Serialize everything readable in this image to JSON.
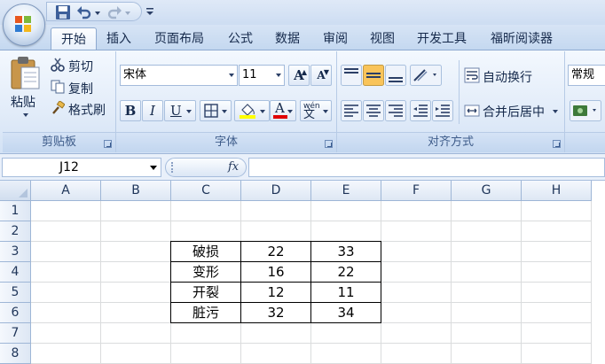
{
  "tabs": [
    "开始",
    "插入",
    "页面布局",
    "公式",
    "数据",
    "审阅",
    "视图",
    "开发工具",
    "福昕阅读器"
  ],
  "clipboard": {
    "paste": "粘贴",
    "cut": "剪切",
    "copy": "复制",
    "format_painter": "格式刷",
    "label": "剪贴板"
  },
  "font": {
    "name": "宋体",
    "size": "11",
    "label": "字体",
    "grow_icon": "A",
    "shrink_icon": "A",
    "bold": "B",
    "italic": "I",
    "underline": "U",
    "font_color_icon": "A",
    "phonetic": "wén"
  },
  "alignment": {
    "wrap_text": "自动换行",
    "merge_center": "合并后居中",
    "label": "对齐方式"
  },
  "number": {
    "format": "常规"
  },
  "formula_bar": {
    "name_box": "J12",
    "fx": "fx",
    "value": ""
  },
  "columns": [
    "A",
    "B",
    "C",
    "D",
    "E",
    "F",
    "G",
    "H"
  ],
  "rows": [
    "1",
    "2",
    "3",
    "4",
    "5",
    "6",
    "7",
    "8"
  ],
  "table": [
    [
      "破损",
      "22",
      "33"
    ],
    [
      "变形",
      "16",
      "22"
    ],
    [
      "开裂",
      "12",
      "11"
    ],
    [
      "脏污",
      "32",
      "34"
    ]
  ],
  "colors": {
    "ribbon_bg": "#e2ecf9",
    "active_button": "#f9c45a",
    "font_color_bar": "#e00000",
    "highlight_bar": "#ffff00"
  },
  "icons": {
    "office": "office-logo-icon",
    "save": "save-icon",
    "undo": "undo-icon",
    "redo": "redo-icon",
    "customize": "customize-qat-icon",
    "paste": "clipboard-icon",
    "cut": "scissors-icon",
    "copy": "copy-icon",
    "format_painter": "brush-icon",
    "borders": "borders-icon",
    "fill": "fill-bucket-icon",
    "wrap": "wrap-text-icon",
    "merge": "merge-icon",
    "accounting": "accounting-icon"
  }
}
